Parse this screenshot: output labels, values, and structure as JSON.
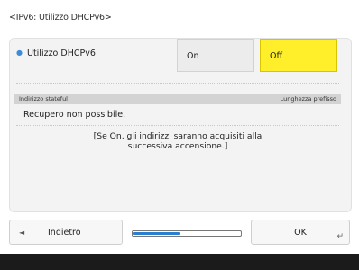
{
  "screen": {
    "title": "<IPv6: Utilizzo DHCPv6>"
  },
  "setting": {
    "label": "Utilizzo DHCPv6",
    "options": [
      {
        "label": "On",
        "selected": false
      },
      {
        "label": "Off",
        "selected": true
      }
    ]
  },
  "table": {
    "headers": [
      "Indirizzo stateful",
      "Lunghezza prefisso"
    ],
    "status_text": "Recupero non possibile."
  },
  "note": {
    "line1": "[Se On, gli indirizzi saranno acquisiti alla",
    "line2": "successiva accensione.]"
  },
  "footer": {
    "back_label": "Indietro",
    "ok_label": "OK",
    "back_icon": "left-arrow-icon",
    "enter_icon": "enter-icon",
    "progress_fraction": 0.45
  },
  "colors": {
    "selected": "#ffee2a",
    "accent": "#2b7fd0"
  }
}
